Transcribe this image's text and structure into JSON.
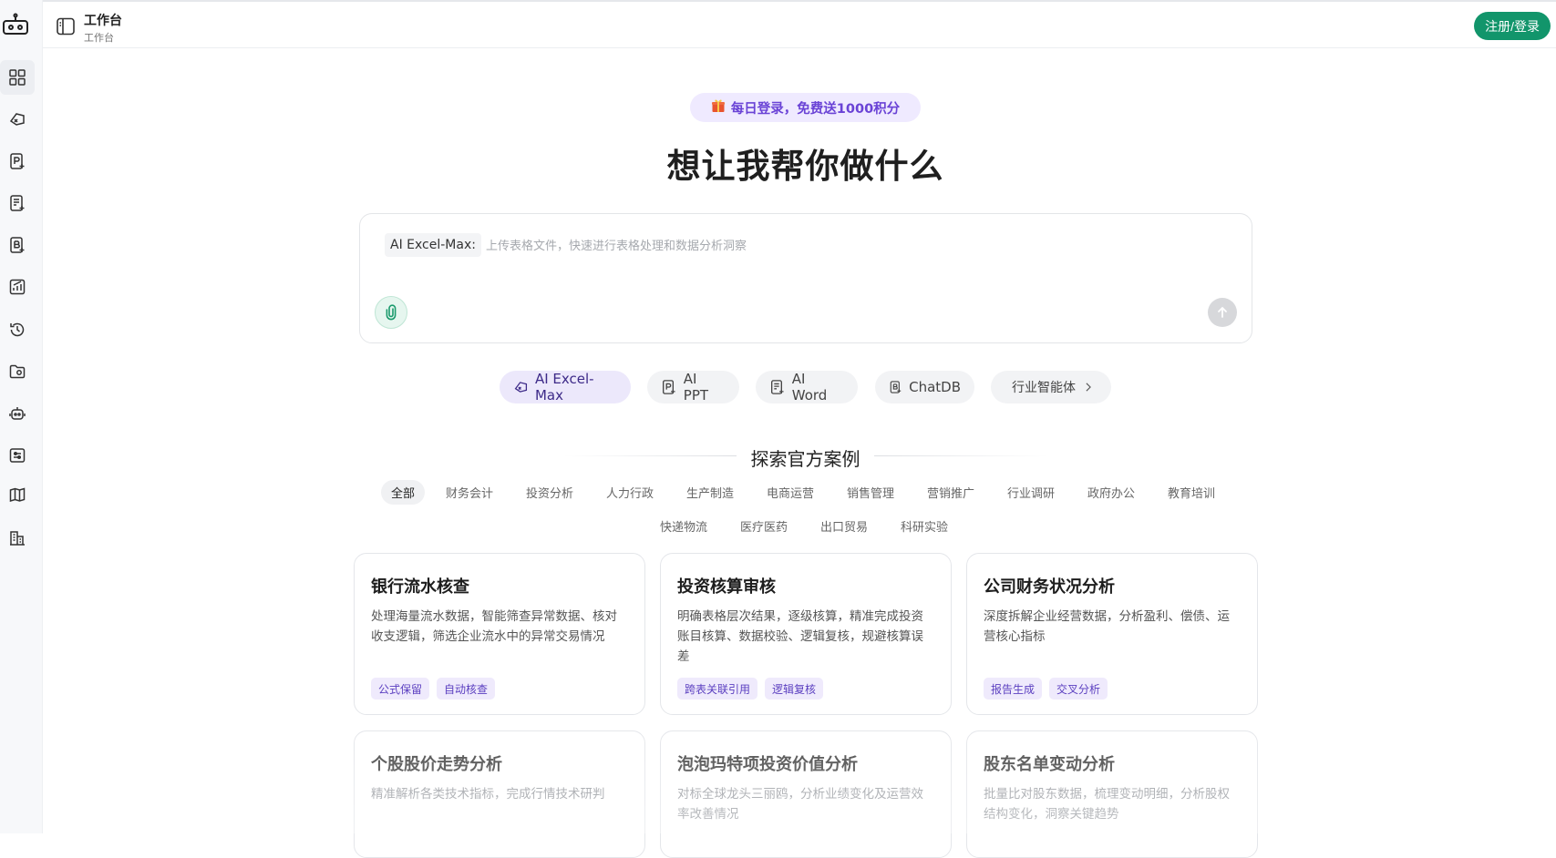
{
  "topbar": {
    "title": "工作台",
    "subtitle": "工作台",
    "login_label": "注册/登录"
  },
  "sidebar": {
    "items": [
      {
        "icon": "grid-icon"
      },
      {
        "icon": "excel-icon"
      },
      {
        "icon": "ppt-icon"
      },
      {
        "icon": "word-icon"
      },
      {
        "icon": "chatdb-icon"
      },
      {
        "icon": "chart-icon"
      },
      {
        "icon": "history-icon"
      },
      {
        "icon": "folder-icon"
      },
      {
        "icon": "robot-icon"
      },
      {
        "icon": "settings-panel-icon"
      },
      {
        "icon": "book-icon"
      },
      {
        "icon": "building-icon"
      }
    ]
  },
  "promo": {
    "label": "每日登录，免费送1000积分"
  },
  "headline": "想让我帮你做什么",
  "composer": {
    "model_tag": "AI Excel-Max:",
    "placeholder": "上传表格文件，快速进行表格处理和数据分析洞察"
  },
  "modes": [
    {
      "label": "AI Excel-Max",
      "active": true
    },
    {
      "label": "AI PPT"
    },
    {
      "label": "AI Word"
    },
    {
      "label": "ChatDB"
    },
    {
      "label": "行业智能体"
    }
  ],
  "section_title": "探索官方案例",
  "categories_row1": [
    "全部",
    "财务会计",
    "投资分析",
    "人力行政",
    "生产制造",
    "电商运营",
    "销售管理",
    "营销推广",
    "行业调研",
    "政府办公",
    "教育培训"
  ],
  "categories_row2": [
    "快递物流",
    "医疗医药",
    "出口贸易",
    "科研实验"
  ],
  "cards": [
    {
      "title": "银行流水核查",
      "desc": "处理海量流水数据，智能筛查异常数据、核对收支逻辑，筛选企业流水中的异常交易情况",
      "tags": [
        "公式保留",
        "自动核查"
      ]
    },
    {
      "title": "投资核算审核",
      "desc": "明确表格层次结果，逐级核算，精准完成投资账目核算、数据校验、逻辑复核，规避核算误差",
      "tags": [
        "跨表关联引用",
        "逻辑复核"
      ]
    },
    {
      "title": "公司财务状况分析",
      "desc": "深度拆解企业经营数据，分析盈利、偿债、运营核心指标",
      "tags": [
        "报告生成",
        "交叉分析"
      ]
    },
    {
      "title": "个股股价走势分析",
      "desc": "精准解析各类技术指标，完成行情技术研判",
      "tags": []
    },
    {
      "title": "泡泡玛特项投资价值分析",
      "desc": "对标全球龙头三丽鸥，分析业绩变化及运营效率改善情况",
      "tags": []
    },
    {
      "title": "股东名单变动分析",
      "desc": "批量比对股东数据，梳理变动明细，分析股权结构变化，洞察关键趋势",
      "tags": []
    }
  ]
}
